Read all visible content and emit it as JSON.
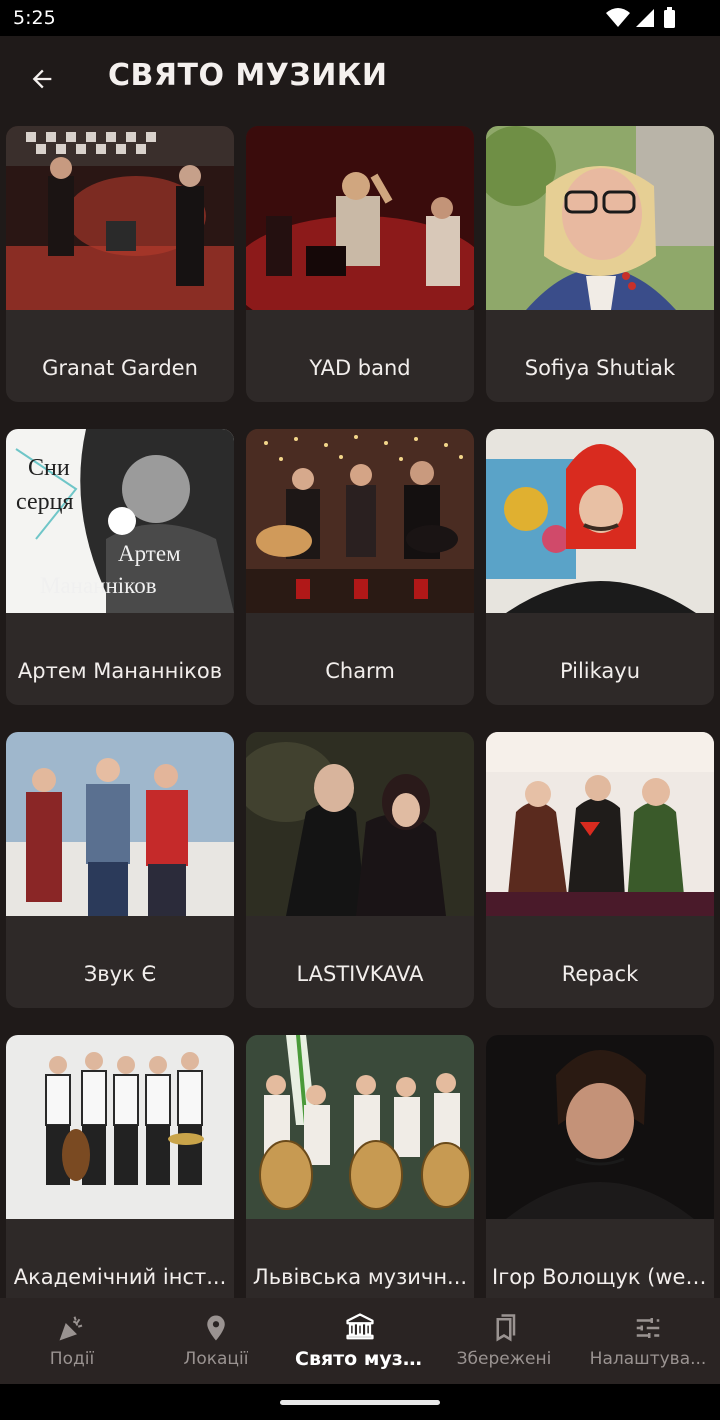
{
  "status_bar": {
    "time": "5:25",
    "icons": [
      "wifi-icon",
      "signal-icon",
      "battery-icon"
    ]
  },
  "app_bar": {
    "title": "СВЯТО МУЗИКИ",
    "back_icon": "arrow-back-icon"
  },
  "artists": [
    {
      "name": "Granat Garden"
    },
    {
      "name": "YAD band"
    },
    {
      "name": "Sofiya Shutiak"
    },
    {
      "name": "Артем Мананніков",
      "cover_text": [
        "Сни",
        "серця",
        "Артем",
        "Мананніков"
      ]
    },
    {
      "name": "Charm"
    },
    {
      "name": "Pilikayu"
    },
    {
      "name": "Звук Є"
    },
    {
      "name": "LASTIVKAVA"
    },
    {
      "name": "Repack"
    },
    {
      "name": "Академічний інст..."
    },
    {
      "name": "Львівська музичн..."
    },
    {
      "name": "Ігор Волощук (wer..."
    }
  ],
  "bottom_nav": [
    {
      "label": "Події",
      "icon": "celebration-icon",
      "active": false
    },
    {
      "label": "Локації",
      "icon": "location-pin-icon",
      "active": false
    },
    {
      "label": "Свято музики",
      "icon": "museum-icon",
      "active": true
    },
    {
      "label": "Збережені",
      "icon": "bookmarks-icon",
      "active": false
    },
    {
      "label": "Налаштува...",
      "icon": "sliders-icon",
      "active": false
    }
  ],
  "colors": {
    "background": "#1f1a19",
    "card": "#2e2928",
    "nav": "#2a2423",
    "text": "#f2eeec",
    "inactive": "#9a9391"
  }
}
